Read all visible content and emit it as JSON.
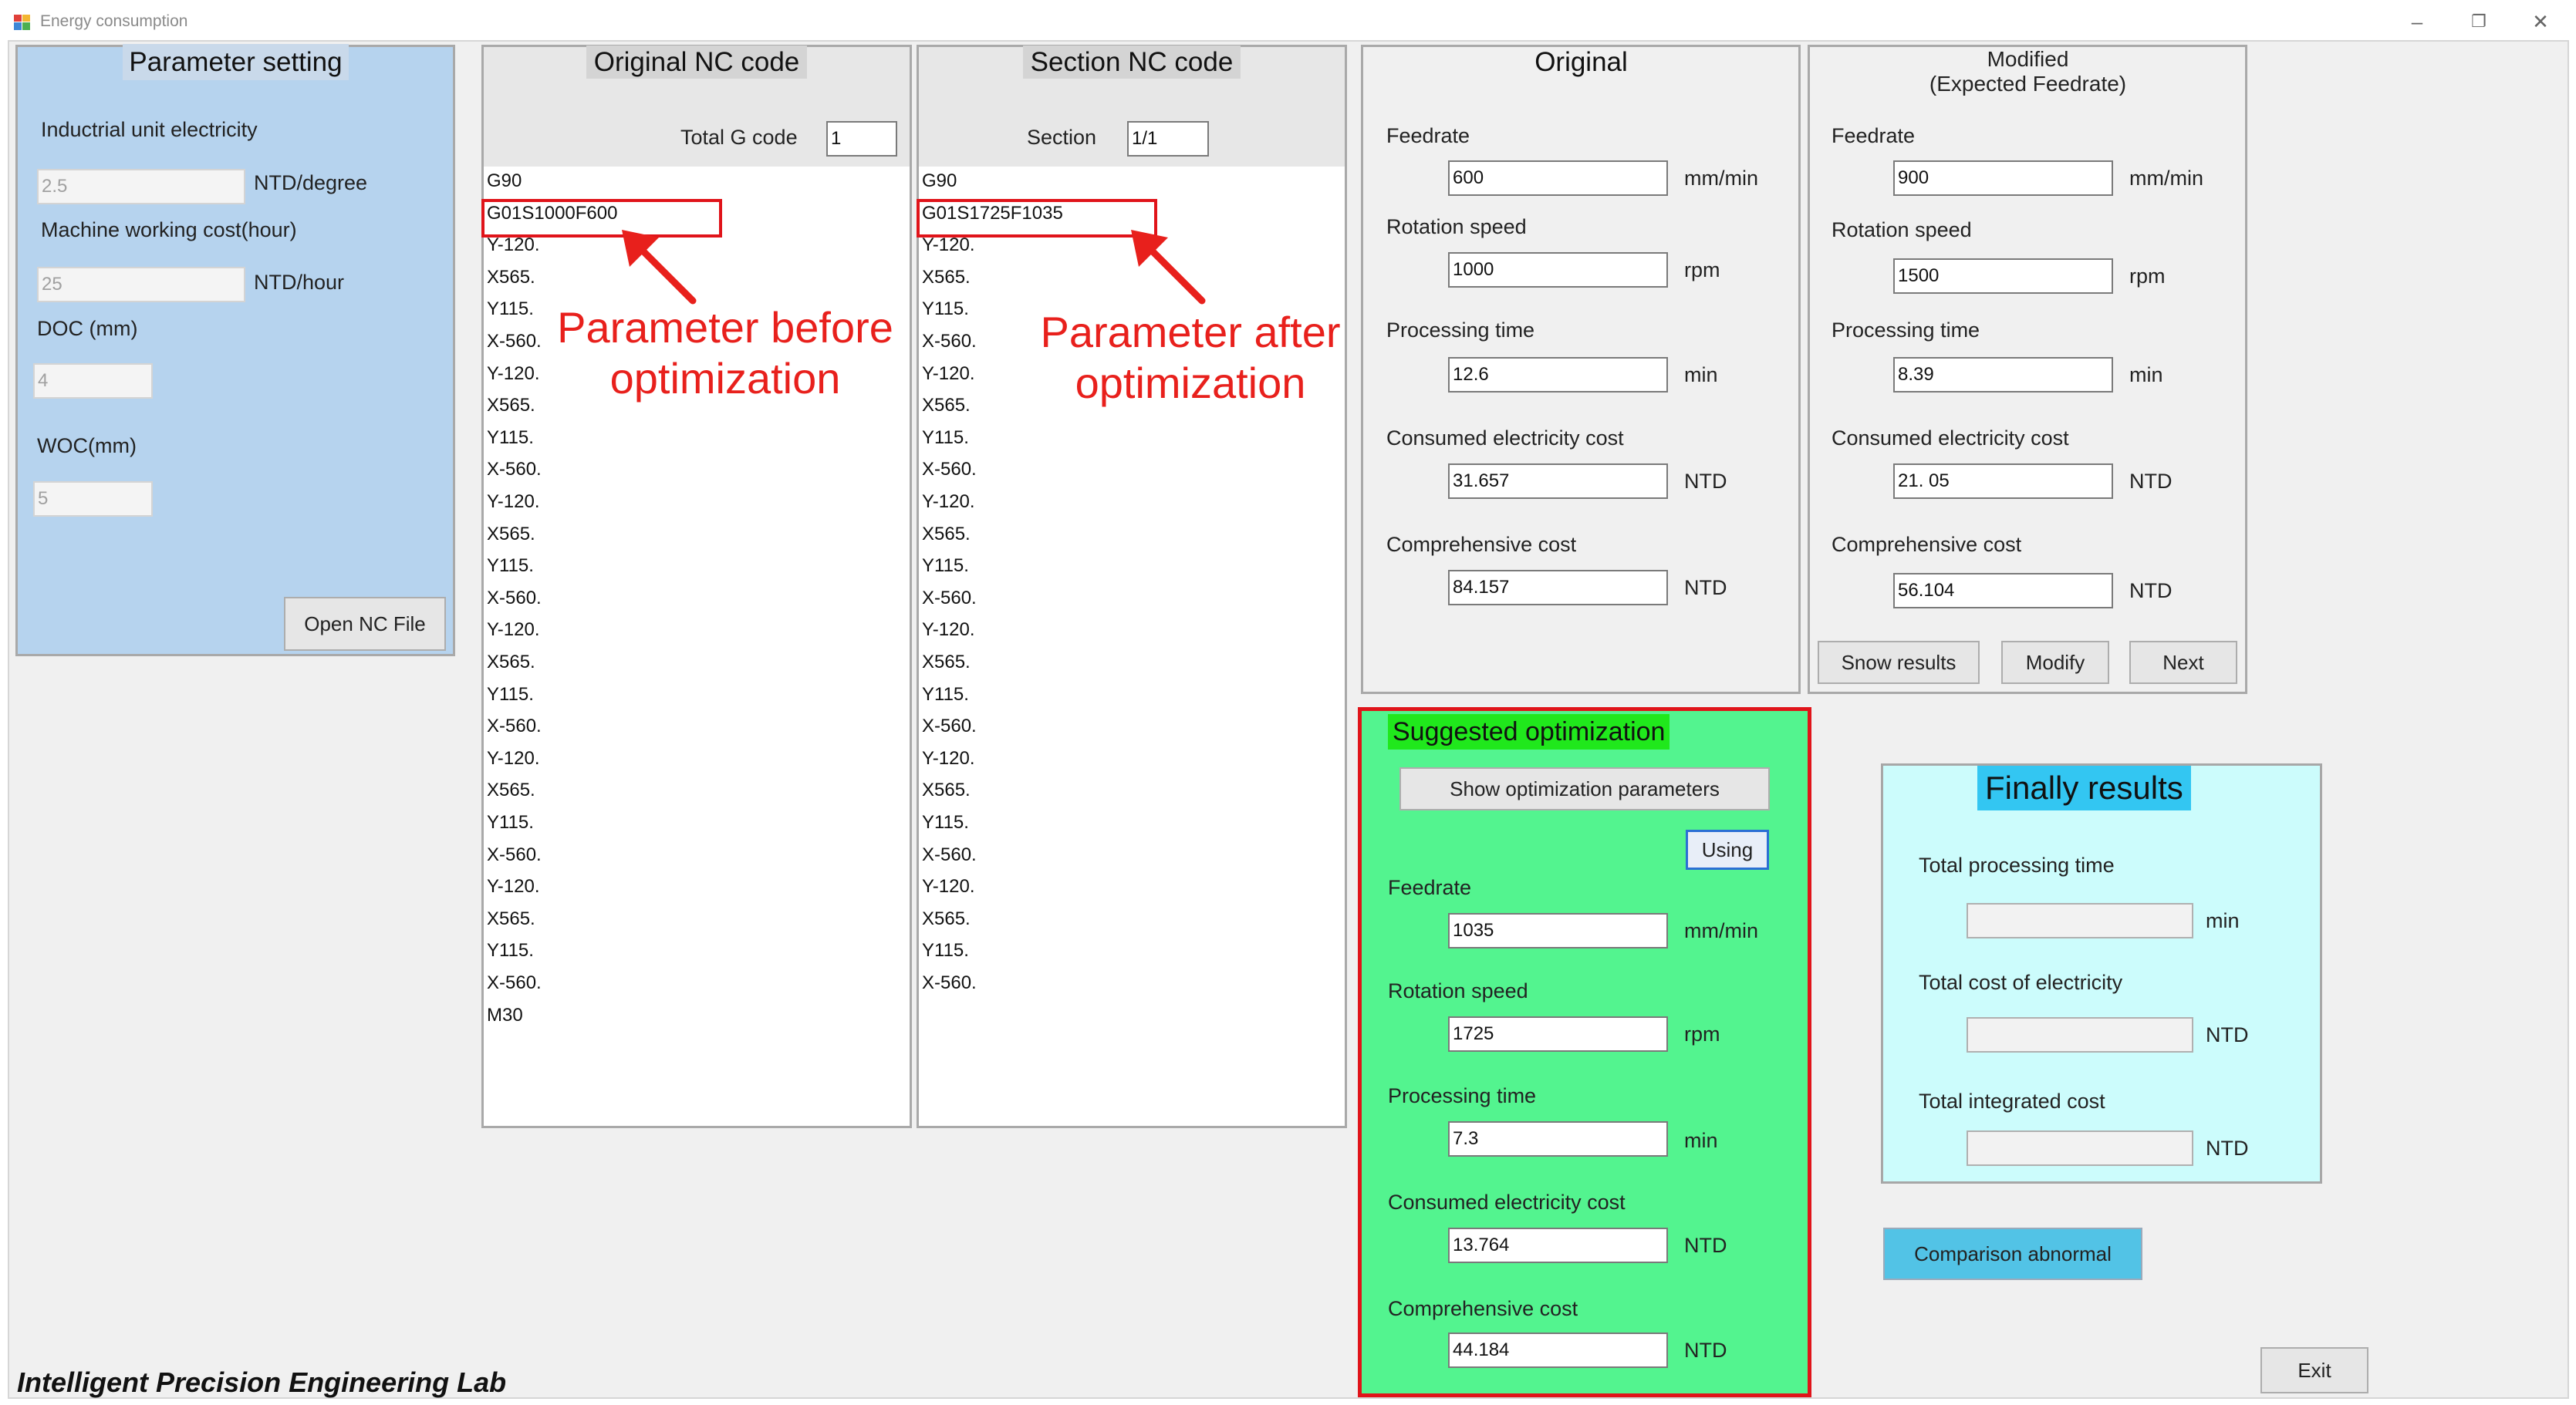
{
  "window": {
    "title": "Energy consumption"
  },
  "parameter_setting": {
    "heading": "Parameter setting",
    "industrial_label": "Inductrial unit electricity",
    "industrial_value": "2.5",
    "industrial_unit": "NTD/degree",
    "machine_label": "Machine working cost(hour)",
    "machine_value": "25",
    "machine_unit": "NTD/hour",
    "doc_label": "DOC (mm)",
    "doc_value": "4",
    "woc_label": "WOC(mm)",
    "woc_value": "5",
    "open_button": "Open NC File"
  },
  "original_nc": {
    "heading": "Original NC code",
    "total_label": "Total G code",
    "total_value": "1",
    "lines": [
      "G90",
      "G01S1000F600",
      "Y-120.",
      "X565.",
      "Y115.",
      "X-560.",
      "Y-120.",
      "X565.",
      "Y115.",
      "X-560.",
      "Y-120.",
      "X565.",
      "Y115.",
      "X-560.",
      "Y-120.",
      "X565.",
      "Y115.",
      "X-560.",
      "Y-120.",
      "X565.",
      "Y115.",
      "X-560.",
      "Y-120.",
      "X565.",
      "Y115.",
      "X-560.",
      "M30"
    ]
  },
  "section_nc": {
    "heading": "Section NC code",
    "section_label": "Section",
    "section_value": "1/1",
    "lines": [
      "G90",
      "G01S1725F1035",
      "Y-120.",
      "X565.",
      "Y115.",
      "X-560.",
      "Y-120.",
      "X565.",
      "Y115.",
      "X-560.",
      "Y-120.",
      "X565.",
      "Y115.",
      "X-560.",
      "Y-120.",
      "X565.",
      "Y115.",
      "X-560.",
      "Y-120.",
      "X565.",
      "Y115.",
      "X-560.",
      "Y-120.",
      "X565.",
      "Y115.",
      "X-560."
    ]
  },
  "annotations": {
    "before": "Parameter before\noptimization",
    "after": "Parameter after\noptimization"
  },
  "original": {
    "heading": "Original",
    "feedrate_label": "Feedrate",
    "feedrate_value": "600",
    "feedrate_unit": "mm/min",
    "rotation_label": "Rotation speed",
    "rotation_value": "1000",
    "rotation_unit": "rpm",
    "time_label": "Processing time",
    "time_value": "12.6",
    "time_unit": "min",
    "elec_label": "Consumed electricity cost",
    "elec_value": "31.657",
    "elec_unit": "NTD",
    "comp_label": "Comprehensive cost",
    "comp_value": "84.157",
    "comp_unit": "NTD"
  },
  "modified": {
    "heading_line1": "Modified",
    "heading_line2": "(Expected Feedrate)",
    "feedrate_label": "Feedrate",
    "feedrate_value": "900",
    "feedrate_unit": "mm/min",
    "rotation_label": "Rotation speed",
    "rotation_value": "1500",
    "rotation_unit": "rpm",
    "time_label": "Processing time",
    "time_value": "8.39",
    "time_unit": "min",
    "elec_label": "Consumed electricity cost",
    "elec_value": "21. 05",
    "elec_unit": "NTD",
    "comp_label": "Comprehensive cost",
    "comp_value": "56.104",
    "comp_unit": "NTD",
    "show_button": "Snow results",
    "modify_button": "Modify",
    "next_button": "Next"
  },
  "suggested": {
    "heading": "Suggested optimization",
    "show_button": "Show optimization parameters",
    "using_button": "Using",
    "feedrate_label": "Feedrate",
    "feedrate_value": "1035",
    "feedrate_unit": "mm/min",
    "rotation_label": "Rotation speed",
    "rotation_value": "1725",
    "rotation_unit": "rpm",
    "time_label": "Processing time",
    "time_value": "7.3",
    "time_unit": "min",
    "elec_label": "Consumed electricity cost",
    "elec_value": "13.764",
    "elec_unit": "NTD",
    "comp_label": "Comprehensive cost",
    "comp_value": "44.184",
    "comp_unit": "NTD"
  },
  "finally": {
    "heading": "Finally results",
    "time_label": "Total processing time",
    "time_value": "",
    "time_unit": "min",
    "elec_label": "Total cost of electricity",
    "elec_value": "",
    "elec_unit": "NTD",
    "integ_label": "Total integrated cost",
    "integ_value": "",
    "integ_unit": "NTD"
  },
  "comparison_button": "Comparison abnormal",
  "exit_button": "Exit",
  "footer_lab": "Intelligent Precision Engineering Lab",
  "colors": {
    "param_bg": "#b6d3ee",
    "suggested_bg": "#53f48f",
    "suggested_heading_bg": "#20e81c",
    "finally_bg": "#ccfcfc",
    "finally_heading_bg": "#33c6f2",
    "comparison_bg": "#52c3e6",
    "highlight_red": "#e0141a"
  }
}
